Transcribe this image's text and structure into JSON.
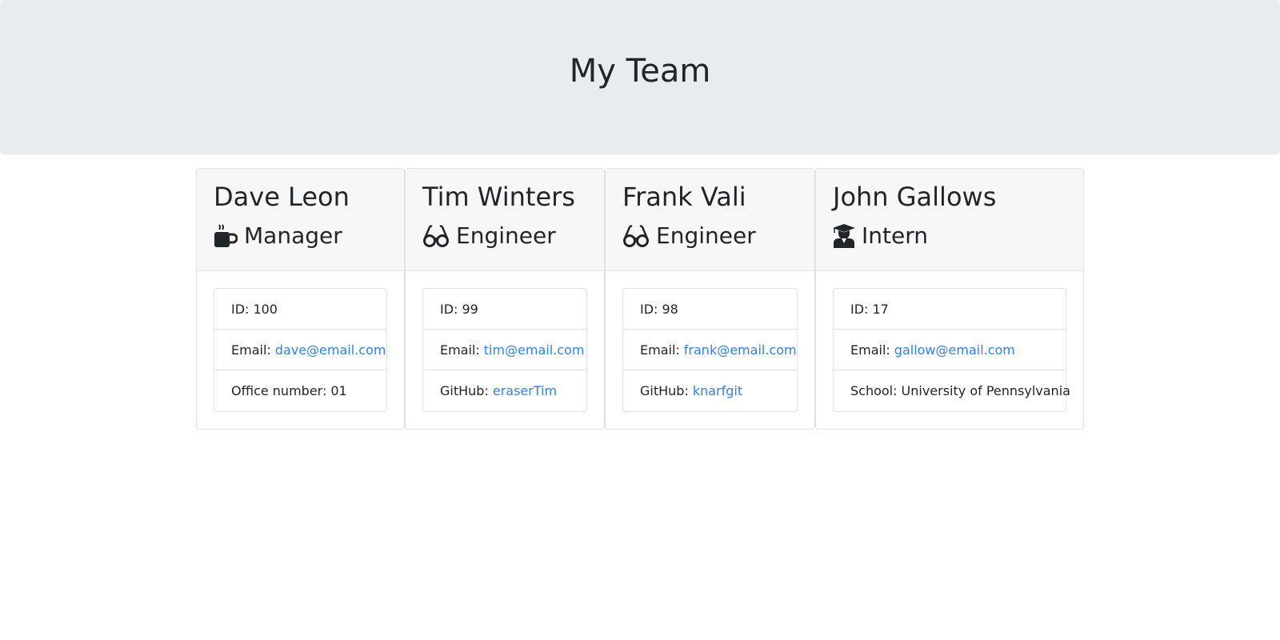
{
  "header": {
    "title": "My Team"
  },
  "colors": {
    "jumbotron_bg": "#e9ecef",
    "card_header_bg": "#f7f7f7",
    "link": "#2f80ed"
  },
  "team": [
    {
      "name": "Dave Leon",
      "role": "Manager",
      "role_icon": "coffee-mug-icon",
      "id_label": "ID:",
      "id": "100",
      "email_label": "Email:",
      "email": "dave@email.com",
      "extra_label": "Office number:",
      "extra": "01"
    },
    {
      "name": "Tim Winters",
      "role": "Engineer",
      "role_icon": "glasses-icon",
      "id_label": "ID:",
      "id": "99",
      "email_label": "Email:",
      "email": "tim@email.com",
      "extra_label": "GitHub:",
      "extra": "eraserTim"
    },
    {
      "name": "Frank Vali",
      "role": "Engineer",
      "role_icon": "glasses-icon",
      "id_label": "ID:",
      "id": "98",
      "email_label": "Email:",
      "email": "frank@email.com",
      "extra_label": "GitHub:",
      "extra": "knarfgit"
    },
    {
      "name": "John Gallows",
      "role": "Intern",
      "role_icon": "graduate-icon",
      "id_label": "ID:",
      "id": "17",
      "email_label": "Email:",
      "email": "gallow@email.com",
      "extra_label": "School:",
      "extra": "University of Pennsylvania"
    }
  ]
}
